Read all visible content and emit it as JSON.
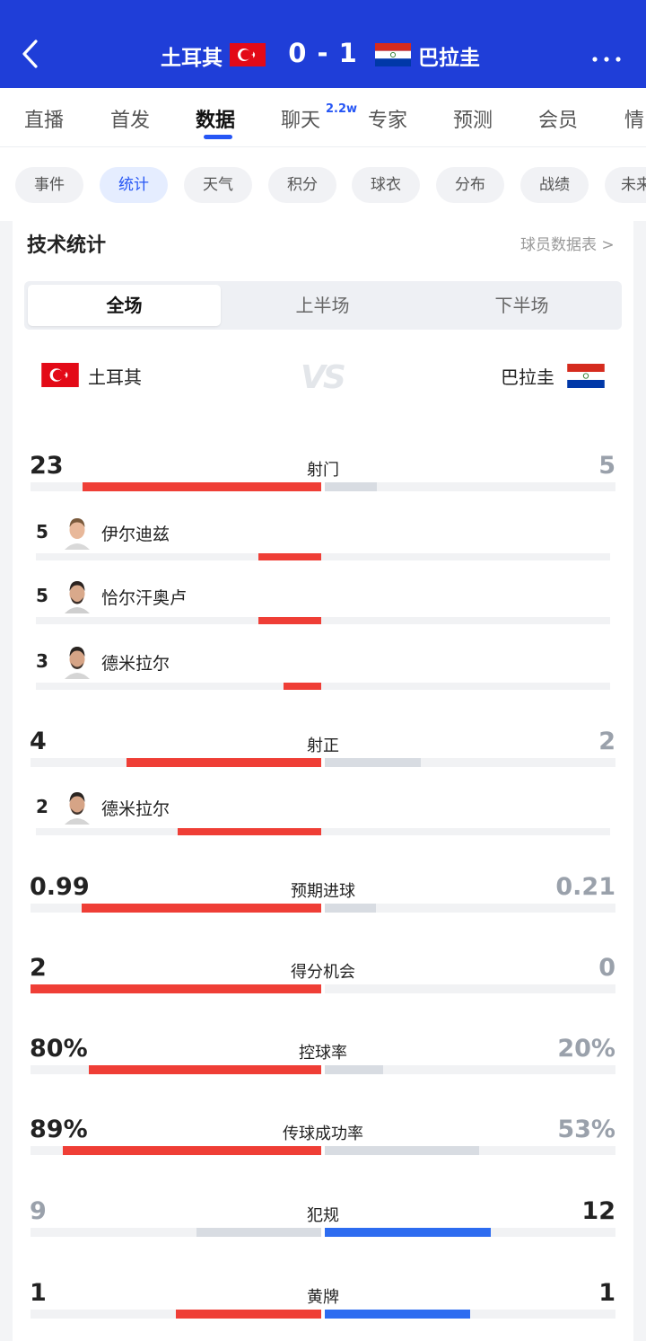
{
  "header": {
    "home_team": "土耳其",
    "away_team": "巴拉圭",
    "score": "0 - 1"
  },
  "main_tabs": [
    {
      "label": "直播",
      "active": false
    },
    {
      "label": "首发",
      "active": false
    },
    {
      "label": "数据",
      "active": true
    },
    {
      "label": "聊天",
      "active": false,
      "badge": "2.2w"
    },
    {
      "label": "专家",
      "active": false
    },
    {
      "label": "预测",
      "active": false
    },
    {
      "label": "会员",
      "active": false
    },
    {
      "label": "情",
      "active": false
    }
  ],
  "sub_tabs": [
    {
      "label": "事件",
      "active": false
    },
    {
      "label": "统计",
      "active": true
    },
    {
      "label": "天气",
      "active": false
    },
    {
      "label": "积分",
      "active": false
    },
    {
      "label": "球衣",
      "active": false
    },
    {
      "label": "分布",
      "active": false
    },
    {
      "label": "战绩",
      "active": false
    },
    {
      "label": "未来",
      "active": false
    }
  ],
  "section": {
    "title": "技术统计",
    "player_link": "球员数据表 >"
  },
  "periods": [
    {
      "label": "全场",
      "active": true
    },
    {
      "label": "上半场",
      "active": false
    },
    {
      "label": "下半场",
      "active": false
    }
  ],
  "teams": {
    "home": "土耳其",
    "away": "巴拉圭",
    "vs": "VS"
  },
  "colors": {
    "brand": "#1f3ed8",
    "accent": "#2656f5",
    "home_bar": "#ef3e36",
    "away_bar": "#2d6cf0",
    "neutral_bar": "#d8dce2"
  },
  "stats": [
    {
      "label": "射门",
      "home": "23",
      "away": "5",
      "home_share": 0.82,
      "away_share": 0.18,
      "leader": "home",
      "players": [
        {
          "value": "5",
          "name": "伊尔迪兹",
          "share": 0.22
        },
        {
          "value": "5",
          "name": "恰尔汗奥卢",
          "share": 0.22
        },
        {
          "value": "3",
          "name": "德米拉尔",
          "share": 0.13
        }
      ]
    },
    {
      "label": "射正",
      "home": "4",
      "away": "2",
      "home_share": 0.67,
      "away_share": 0.33,
      "leader": "home",
      "players": [
        {
          "value": "2",
          "name": "德米拉尔",
          "share": 0.5
        }
      ]
    },
    {
      "label": "预期进球",
      "home": "0.99",
      "away": "0.21",
      "home_share": 0.825,
      "away_share": 0.175,
      "leader": "home",
      "players": []
    },
    {
      "label": "得分机会",
      "home": "2",
      "away": "0",
      "home_share": 1.0,
      "away_share": 0.0,
      "leader": "home",
      "players": []
    },
    {
      "label": "控球率",
      "home": "80%",
      "away": "20%",
      "home_share": 0.8,
      "away_share": 0.2,
      "leader": "home",
      "players": []
    },
    {
      "label": "传球成功率",
      "home": "89%",
      "away": "53%",
      "home_share": 0.89,
      "away_share": 0.53,
      "leader": "home",
      "players": []
    },
    {
      "label": "犯规",
      "home": "9",
      "away": "12",
      "home_share": 0.43,
      "away_share": 0.57,
      "leader": "away",
      "players": []
    },
    {
      "label": "黄牌",
      "home": "1",
      "away": "1",
      "home_share": 0.5,
      "away_share": 0.5,
      "leader": "both",
      "players": []
    }
  ]
}
